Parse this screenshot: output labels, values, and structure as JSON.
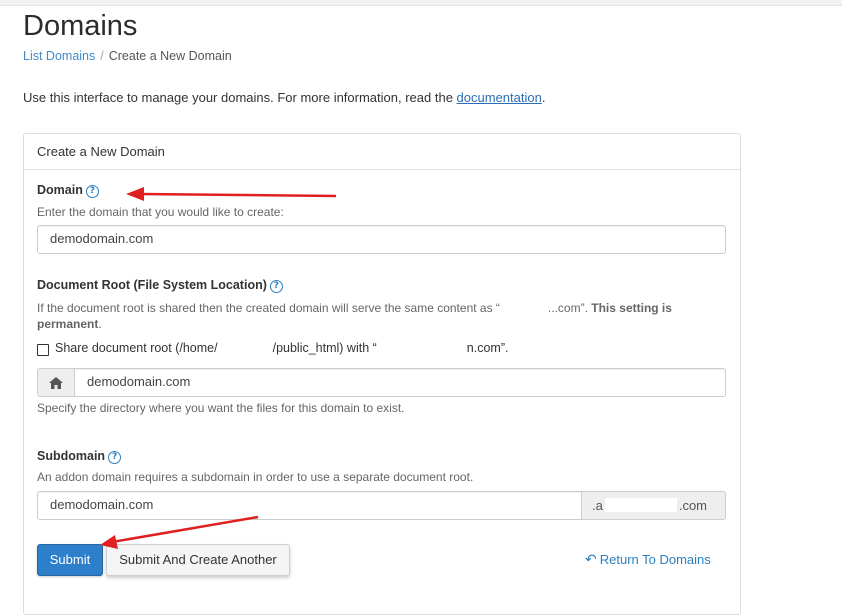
{
  "page": {
    "title": "Domains",
    "breadcrumb": {
      "link": "List Domains",
      "separator": "/",
      "current": "Create a New Domain"
    },
    "intro_text": "Use this interface to manage your domains. For more information, read the ",
    "intro_link": "documentation",
    "intro_end": "."
  },
  "panel": {
    "heading": "Create a New Domain",
    "domain": {
      "label": "Domain",
      "help": "Enter the domain that you would like to create:",
      "value": "demodomain.com"
    },
    "docroot": {
      "label": "Document Root (File System Location)",
      "help_prefix": "If the document root is shared then the created domain will serve the same content as “",
      "help_domain": "...com",
      "help_mid": "”. ",
      "help_bold_1": "This setting is",
      "help_bold_2": "permanent",
      "help_end": ".",
      "share_label_1": "Share document root (/home/",
      "share_label_2": "/public_html) with “",
      "share_label_3": "n.com”.",
      "home_icon": "home-icon",
      "value": "demodomain.com",
      "hint": "Specify the directory where you want the files for this domain to exist."
    },
    "subdomain": {
      "label": "Subdomain",
      "help": "An addon domain requires a subdomain in order to use a separate document root.",
      "value": "demodomain.com",
      "suffix_start": ".a",
      "suffix_end": ".com"
    },
    "buttons": {
      "submit": "Submit",
      "submit_another": "Submit And Create Another",
      "return_link": "Return To Domains"
    }
  },
  "colors": {
    "accent": "#2e7fc9",
    "link": "#428bca",
    "annotation_arrow": "#e02020"
  }
}
